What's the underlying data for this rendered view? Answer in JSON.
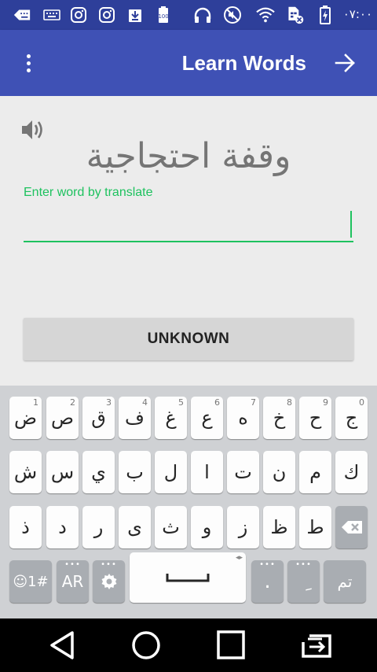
{
  "status_bar": {
    "time": "٠٧:٠٠",
    "icons": [
      "keyboard-status-icon",
      "keyboard-icon",
      "instagram-icon",
      "instagram-icon",
      "download-icon",
      "battery-100-icon",
      "headphones-icon",
      "mute-icon",
      "wifi-icon",
      "sim-off-icon",
      "battery-charging-icon"
    ]
  },
  "app_bar": {
    "title": "Learn Words",
    "color": "#3f51b5",
    "status_color": "#2e3f9a"
  },
  "content": {
    "word": "وقفة احتجاجية",
    "field_label": "Enter word by translate",
    "input_value": "",
    "accent_color": "#1ec25f",
    "unknown_label": "UNKNOWN"
  },
  "keyboard": {
    "row1": [
      {
        "char": "ض",
        "hint": "1"
      },
      {
        "char": "ص",
        "hint": "2"
      },
      {
        "char": "ق",
        "hint": "3"
      },
      {
        "char": "ف",
        "hint": "4"
      },
      {
        "char": "غ",
        "hint": "5"
      },
      {
        "char": "ع",
        "hint": "6"
      },
      {
        "char": "ه",
        "hint": "7"
      },
      {
        "char": "خ",
        "hint": "8"
      },
      {
        "char": "ح",
        "hint": "9"
      },
      {
        "char": "ج",
        "hint": "0"
      }
    ],
    "row2": [
      "ش",
      "س",
      "ي",
      "ب",
      "ل",
      "ا",
      "ت",
      "ن",
      "م",
      "ك"
    ],
    "row3": [
      "ذ",
      "د",
      "ر",
      "ى",
      "ث",
      "و",
      "ز",
      "ظ",
      "ط"
    ],
    "symbols_label": "☺1#",
    "lang_label": "AR",
    "period_label": ".",
    "kasra_label": "ِ",
    "done_label": "تم"
  },
  "nav_bar": {
    "buttons": [
      "back",
      "home",
      "recents",
      "screen-switch"
    ]
  }
}
